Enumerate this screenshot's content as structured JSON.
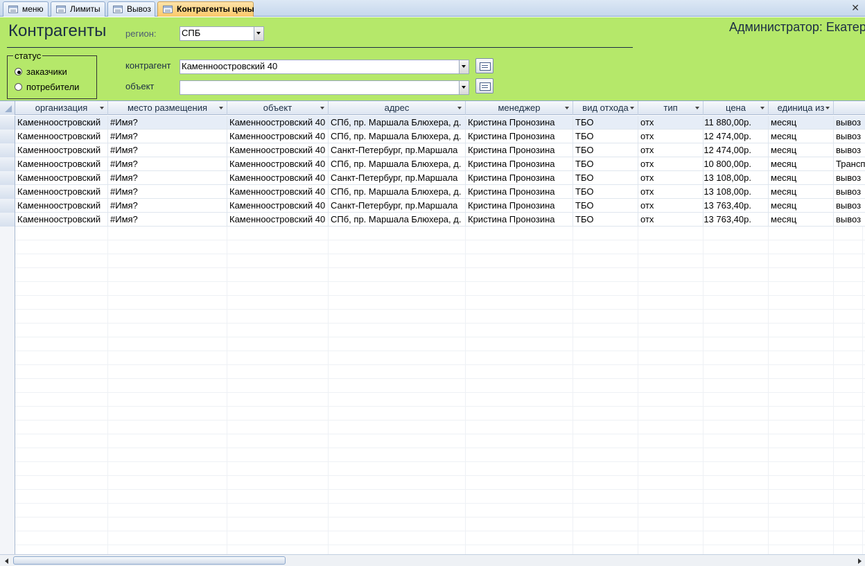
{
  "tabs": [
    {
      "label": "меню",
      "active": false
    },
    {
      "label": "Лимиты",
      "active": false
    },
    {
      "label": "Вывоз",
      "active": false
    },
    {
      "label": "Контрагенты цены",
      "active": true
    }
  ],
  "close_glyph": "✕",
  "form": {
    "title": "Контрагенты",
    "user": "Администратор: Екатер",
    "region_label": "регион:",
    "region_value": "СПБ",
    "status_legend": "статус",
    "status_options": [
      {
        "label": "заказчики",
        "selected": true
      },
      {
        "label": "потребители",
        "selected": false
      }
    ],
    "contractor_label": "контрагент",
    "contractor_value": "Каменноостровский 40",
    "object_label": "объект",
    "object_value": ""
  },
  "colors": {
    "header_bg": "#b5e86a",
    "active_tab": "#fbc86a"
  },
  "table": {
    "columns": [
      "организация",
      "место размещения",
      "объект",
      "адрес",
      "менеджер",
      "вид отхода",
      "тип",
      "цена",
      "единица из",
      ""
    ],
    "rows": [
      [
        "Каменноостровский",
        "#Имя?",
        "Каменноостровский 40",
        "СПб, пр. Маршала Блюхера, д.",
        "Кристина Пронозина",
        "ТБО",
        "отх",
        "11 880,00р.",
        "месяц",
        "вывоз"
      ],
      [
        "Каменноостровский",
        "#Имя?",
        "Каменноостровский 40",
        "СПб, пр. Маршала Блюхера, д.",
        "Кристина Пронозина",
        "ТБО",
        "отх",
        "12 474,00р.",
        "месяц",
        "вывоз"
      ],
      [
        "Каменноостровский",
        "#Имя?",
        "Каменноостровский 40",
        "Санкт-Петербург, пр.Маршала",
        "Кристина Пронозина",
        "ТБО",
        "отх",
        "12 474,00р.",
        "месяц",
        "вывоз"
      ],
      [
        "Каменноостровский",
        "#Имя?",
        "Каменноостровский 40",
        "СПб, пр. Маршала Блюхера, д.",
        "Кристина Пронозина",
        "ТБО",
        "отх",
        "10 800,00р.",
        "месяц",
        "Трансп"
      ],
      [
        "Каменноостровский",
        "#Имя?",
        "Каменноостровский 40",
        "Санкт-Петербург, пр.Маршала",
        "Кристина Пронозина",
        "ТБО",
        "отх",
        "13 108,00р.",
        "месяц",
        "вывоз"
      ],
      [
        "Каменноостровский",
        "#Имя?",
        "Каменноостровский 40",
        "СПб, пр. Маршала Блюхера, д.",
        "Кристина Пронозина",
        "ТБО",
        "отх",
        "13 108,00р.",
        "месяц",
        "вывоз"
      ],
      [
        "Каменноостровский",
        "#Имя?",
        "Каменноостровский 40",
        "Санкт-Петербург, пр.Маршала",
        "Кристина Пронозина",
        "ТБО",
        "отх",
        "13 763,40р.",
        "месяц",
        "вывоз"
      ],
      [
        "Каменноостровский",
        "#Имя?",
        "Каменноостровский 40",
        "СПб, пр. Маршала Блюхера, д.",
        "Кристина Пронозина",
        "ТБО",
        "отх",
        "13 763,40р.",
        "месяц",
        "вывоз"
      ]
    ]
  }
}
